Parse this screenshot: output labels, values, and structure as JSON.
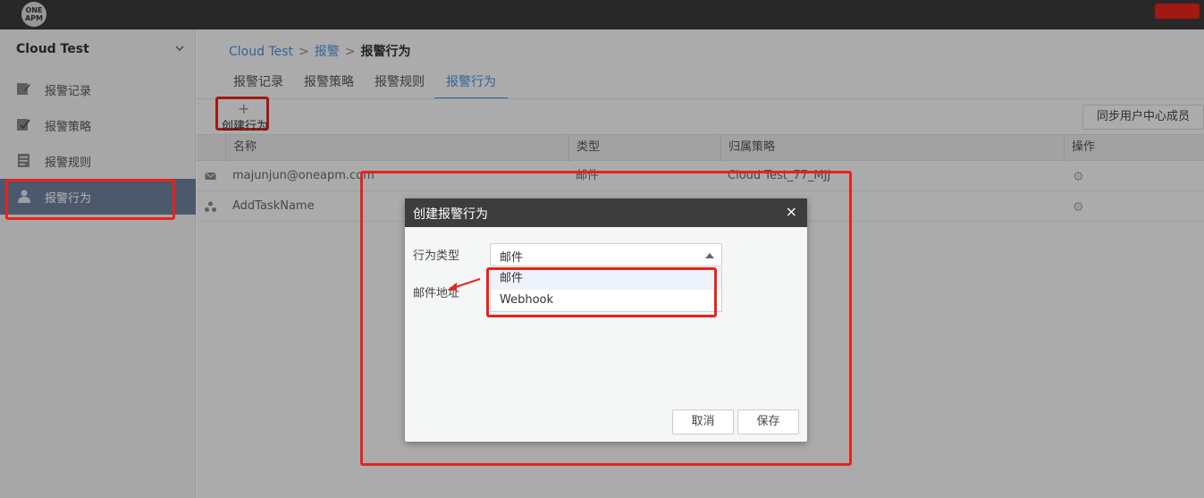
{
  "topbar": {
    "logo_text": "ONE APM"
  },
  "sidebar": {
    "title": "Cloud Test",
    "items": [
      {
        "label": "报警记录",
        "icon": "edit-icon"
      },
      {
        "label": "报警策略",
        "icon": "checklist-icon"
      },
      {
        "label": "报警规则",
        "icon": "document-icon"
      },
      {
        "label": "报警行为",
        "icon": "user-action-icon",
        "active": true
      }
    ]
  },
  "breadcrumb": {
    "root": "Cloud Test",
    "sep1": ">",
    "level1": "报警",
    "sep2": ">",
    "current": "报警行为"
  },
  "tabs": [
    {
      "label": "报警记录"
    },
    {
      "label": "报警策略"
    },
    {
      "label": "报警规则"
    },
    {
      "label": "报警行为",
      "active": true
    }
  ],
  "toolbar": {
    "create_plus": "+",
    "create_label": "创建行为",
    "sync_label": "同步用户中心成员"
  },
  "table": {
    "headers": [
      "名称",
      "类型",
      "归属策略",
      "操作"
    ],
    "rows": [
      {
        "icon": "mail-icon",
        "name": "majunjun@oneapm.com",
        "type": "邮件",
        "policy": "Cloud Test_77_MJJ"
      },
      {
        "icon": "webhook-icon",
        "name": "AddTaskName",
        "type": "",
        "policy": ""
      }
    ]
  },
  "modal": {
    "title": "创建报警行为",
    "close": "×",
    "type_label": "行为类型",
    "type_value": "邮件",
    "email_label": "邮件地址",
    "options": [
      "邮件",
      "Webhook"
    ],
    "cancel_label": "取消",
    "save_label": "保存"
  },
  "colors": {
    "accent": "#4a90d9",
    "annotation": "#e8231b",
    "sidebar_active": "#6e7f9b",
    "header_bg": "#3a3a3a"
  }
}
